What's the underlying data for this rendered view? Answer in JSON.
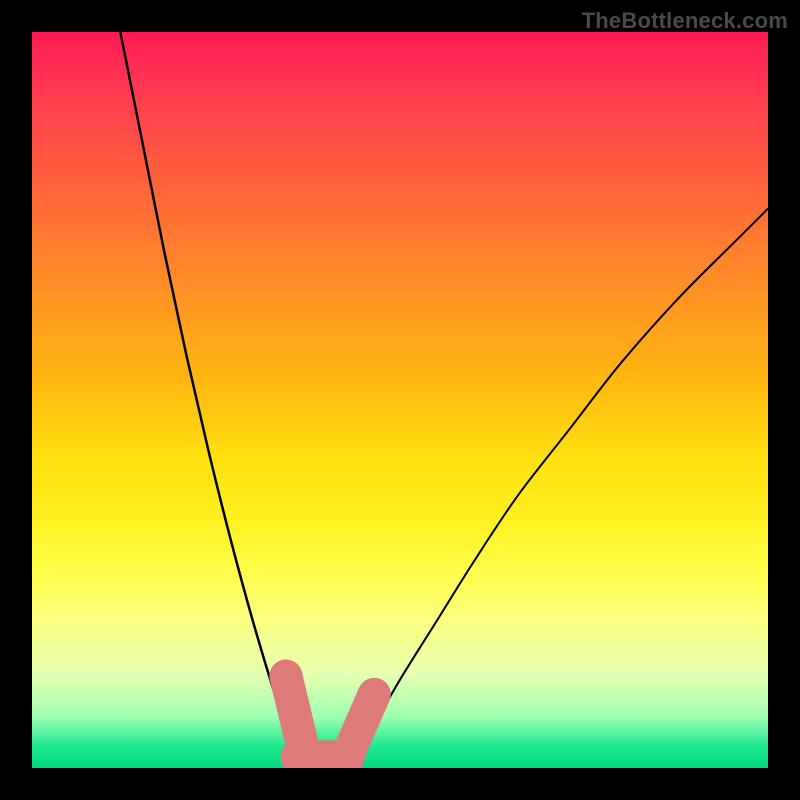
{
  "credit": "TheBottleneck.com",
  "chart_data": {
    "type": "line",
    "title": "",
    "xlabel": "",
    "ylabel": "",
    "xlim": [
      0,
      100
    ],
    "ylim": [
      0,
      100
    ],
    "grid": false,
    "legend": false,
    "series": [
      {
        "name": "left-curve",
        "x": [
          12,
          15,
          18,
          21,
          24,
          27,
          30,
          33,
          35,
          37
        ],
        "y": [
          100,
          85,
          70,
          56,
          43,
          31,
          20,
          10,
          4,
          0
        ]
      },
      {
        "name": "right-curve",
        "x": [
          43,
          46,
          50,
          55,
          60,
          66,
          73,
          80,
          88,
          96,
          100
        ],
        "y": [
          0,
          5,
          12,
          20,
          28,
          37,
          46,
          55,
          64,
          72,
          76
        ]
      }
    ],
    "markers": [
      {
        "name": "marker-left-cap",
        "kind": "capsule",
        "color": "#dd7b7b",
        "x1": 34.5,
        "y1": 12.5,
        "x2": 37.0,
        "y2": 2.0,
        "width_pct": 4.5
      },
      {
        "name": "marker-bottom-bar",
        "kind": "capsule",
        "color": "#dd7b7b",
        "x1": 36.0,
        "y1": 1.5,
        "x2": 43.0,
        "y2": 1.5,
        "width_pct": 4.5
      },
      {
        "name": "marker-right-cap",
        "kind": "capsule",
        "color": "#dd7b7b",
        "x1": 43.0,
        "y1": 2.0,
        "x2": 46.5,
        "y2": 10.0,
        "width_pct": 4.5
      }
    ],
    "gradient_stops": [
      {
        "pct": 0,
        "color": "#ff1a55"
      },
      {
        "pct": 50,
        "color": "#ffe010"
      },
      {
        "pct": 100,
        "color": "#00d880"
      }
    ]
  }
}
